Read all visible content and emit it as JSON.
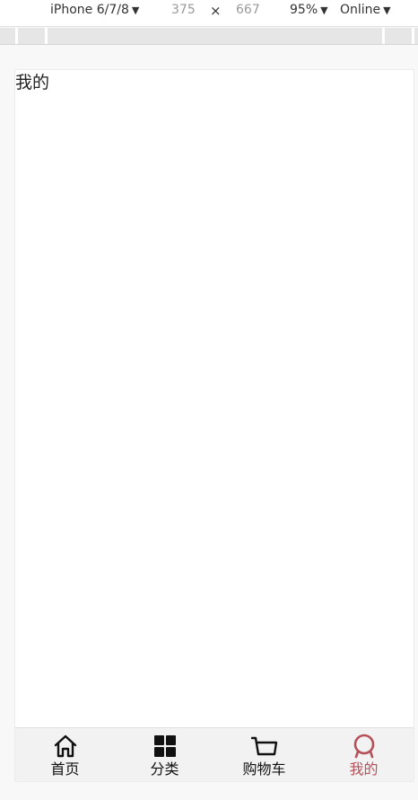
{
  "devtools": {
    "device": "iPhone 6/7/8",
    "width": "375",
    "separator": "×",
    "height": "667",
    "zoom": "95%",
    "network": "Online"
  },
  "page": {
    "title": "我的"
  },
  "tabbar": {
    "active_color": "#b5505a",
    "items": [
      {
        "label": "首页",
        "icon": "home-icon"
      },
      {
        "label": "分类",
        "icon": "category-grid-icon"
      },
      {
        "label": "购物车",
        "icon": "cart-icon"
      },
      {
        "label": "我的",
        "icon": "profile-icon",
        "active": true
      }
    ]
  }
}
